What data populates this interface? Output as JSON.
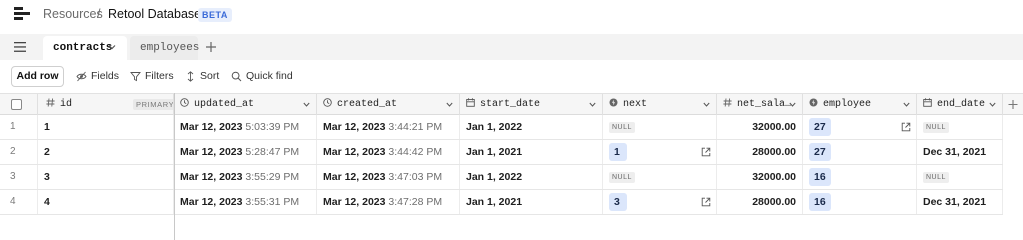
{
  "breadcrumb": {
    "root": "Resources",
    "separator": "/",
    "current": "Retool Database",
    "badge": "BETA"
  },
  "tabs": [
    {
      "label": "contracts",
      "active": true
    },
    {
      "label": "employees",
      "active": false
    }
  ],
  "toolbar": {
    "add_row": "Add row",
    "fields": "Fields",
    "filters": "Filters",
    "sort": "Sort",
    "quick_find": "Quick find"
  },
  "columns": [
    {
      "key": "id",
      "label": "id",
      "badge": "PRIMARY KEY",
      "icon": "hash-icon"
    },
    {
      "key": "updated_at",
      "label": "updated_at",
      "icon": "clock-icon"
    },
    {
      "key": "created_at",
      "label": "created_at",
      "icon": "clock-icon"
    },
    {
      "key": "start_date",
      "label": "start_date",
      "icon": "calendar-icon"
    },
    {
      "key": "next",
      "label": "next",
      "icon": "bolt-icon"
    },
    {
      "key": "net_salary",
      "label": "net_sala…",
      "icon": "hash-icon"
    },
    {
      "key": "employee",
      "label": "employee",
      "icon": "bolt-icon"
    },
    {
      "key": "end_date",
      "label": "end_date",
      "icon": "calendar-icon"
    }
  ],
  "null_label": "NULL",
  "rows": [
    {
      "n": "1",
      "id": "1",
      "updated_date": "Mar 12, 2023",
      "updated_time": "5:03:39 PM",
      "created_date": "Mar 12, 2023",
      "created_time": "3:44:21 PM",
      "start_date": "Jan 1, 2022",
      "next": null,
      "net_salary": "32000.00",
      "employee": "27",
      "end_date": null
    },
    {
      "n": "2",
      "id": "2",
      "updated_date": "Mar 12, 2023",
      "updated_time": "5:28:47 PM",
      "created_date": "Mar 12, 2023",
      "created_time": "3:44:42 PM",
      "start_date": "Jan 1, 2021",
      "next": "1",
      "net_salary": "28000.00",
      "employee": "27",
      "end_date": "Dec 31, 2021"
    },
    {
      "n": "3",
      "id": "3",
      "updated_date": "Mar 12, 2023",
      "updated_time": "3:55:29 PM",
      "created_date": "Mar 12, 2023",
      "created_time": "3:47:03 PM",
      "start_date": "Jan 1, 2022",
      "next": null,
      "net_salary": "32000.00",
      "employee": "16",
      "end_date": null
    },
    {
      "n": "4",
      "id": "4",
      "updated_date": "Mar 12, 2023",
      "updated_time": "3:55:31 PM",
      "created_date": "Mar 12, 2023",
      "created_time": "3:47:28 PM",
      "start_date": "Jan 1, 2021",
      "next": "3",
      "net_salary": "28000.00",
      "employee": "16",
      "end_date": "Dec 31, 2021"
    }
  ],
  "colors": {
    "accent": "#3a6ad8",
    "fk_chip": "#dbe6fb",
    "header_bg": "#f6f6f6",
    "tabbar_bg": "#f3f3f3"
  }
}
